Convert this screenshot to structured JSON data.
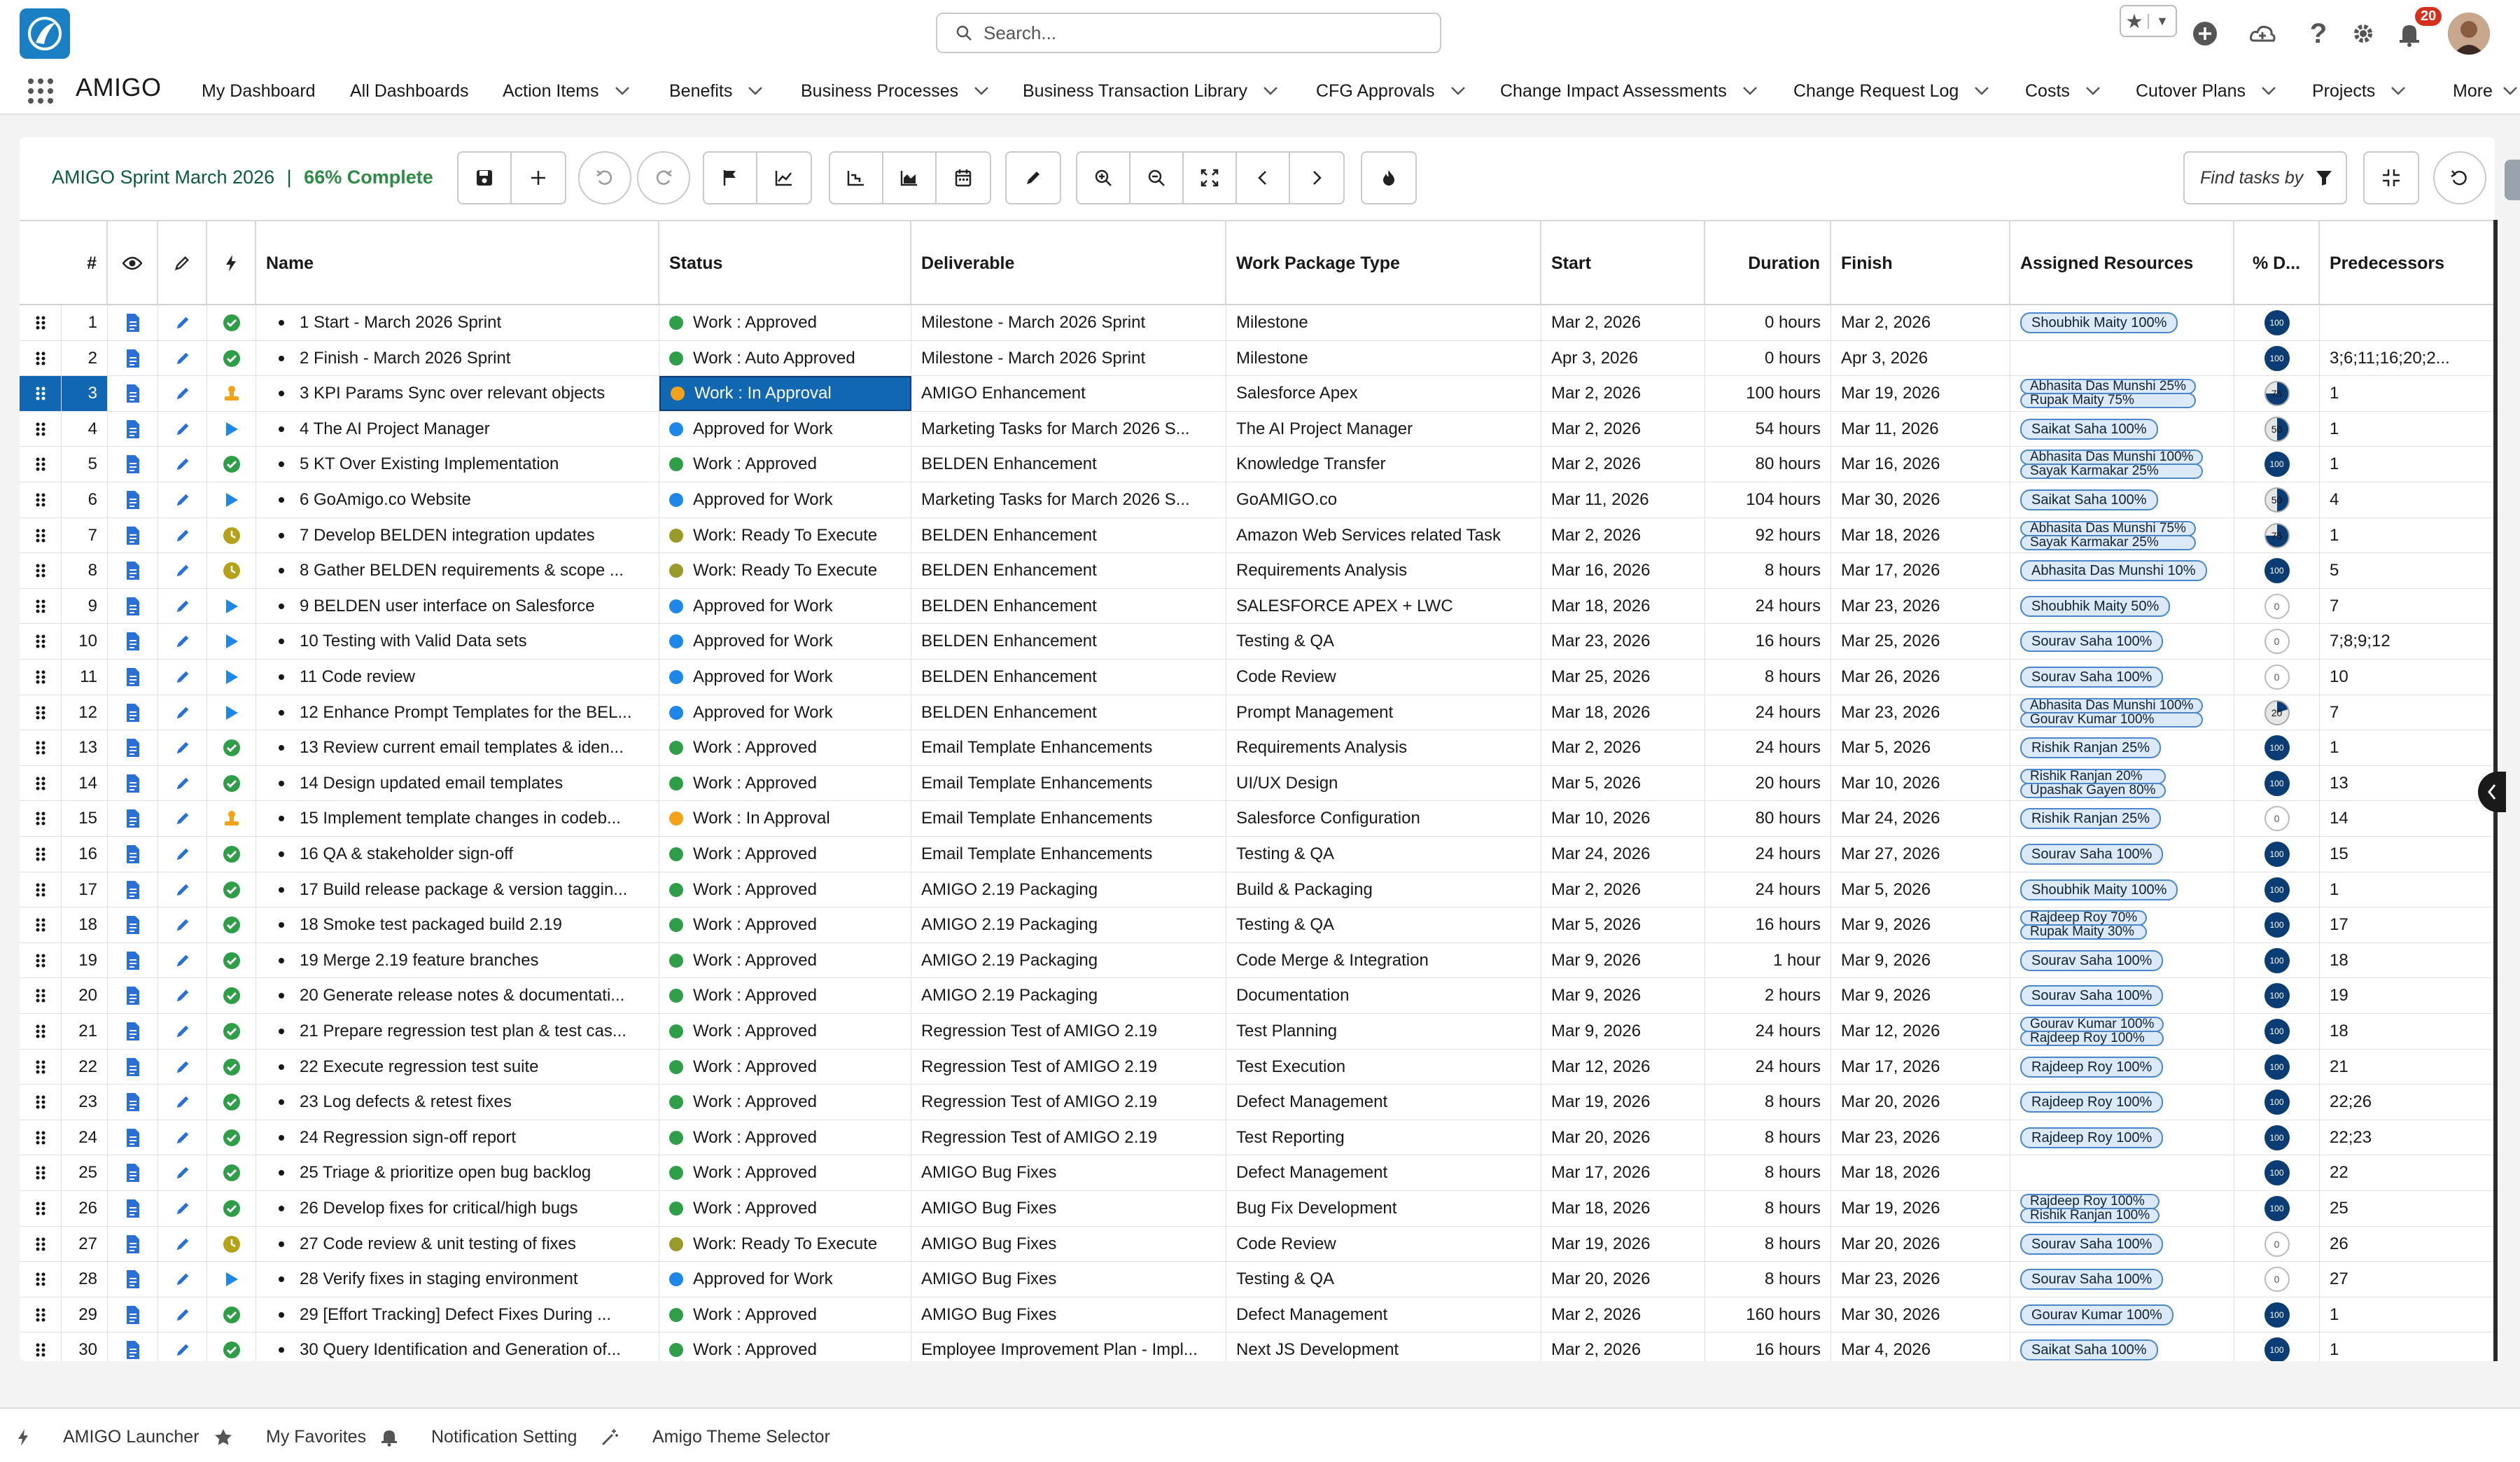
{
  "app": {
    "name": "AMIGO",
    "notification_count": "20"
  },
  "search": {
    "placeholder": "Search..."
  },
  "nav": {
    "items": [
      {
        "label": "My Dashboard",
        "dropdown": false
      },
      {
        "label": "All Dashboards",
        "dropdown": false
      },
      {
        "label": "Action Items",
        "dropdown": true
      },
      {
        "label": "Benefits",
        "dropdown": true
      },
      {
        "label": "Business Processes",
        "dropdown": true
      },
      {
        "label": "Business Transaction Library",
        "dropdown": true
      },
      {
        "label": "CFG Approvals",
        "dropdown": true
      },
      {
        "label": "Change Impact Assessments",
        "dropdown": true
      },
      {
        "label": "Change Request Log",
        "dropdown": true
      },
      {
        "label": "Costs",
        "dropdown": true
      },
      {
        "label": "Cutover Plans",
        "dropdown": true
      },
      {
        "label": "Projects",
        "dropdown": true
      },
      {
        "label": "More",
        "dropdown": true
      }
    ]
  },
  "project": {
    "name": "AMIGO Sprint March 2026",
    "separator": "|",
    "complete": "66% Complete"
  },
  "find": {
    "placeholder": "Find tasks by"
  },
  "columns": {
    "num": "#",
    "name": "Name",
    "status": "Status",
    "deliverable": "Deliverable",
    "wptype": "Work Package Type",
    "start": "Start",
    "duration": "Duration",
    "finish": "Finish",
    "resources": "Assigned Resources",
    "pct": "% D...",
    "pred": "Predecessors"
  },
  "status_colors": {
    "approved": "#2e9e48",
    "in_approval": "#f2a21b",
    "ready": "#9a9a2a",
    "approved_for_work": "#1f87e8"
  },
  "rows": [
    {
      "n": "1",
      "icon": "check",
      "name": "1 Start - March 2026 Sprint",
      "status": "Work : Approved",
      "sc": "approved",
      "deliverable": "Milestone - March 2026 Sprint",
      "wptype": "Milestone",
      "start": "Mar 2, 2026",
      "duration": "0 hours",
      "finish": "Mar 2, 2026",
      "res": [
        "Shoubhik Maity 100%"
      ],
      "pct": "100",
      "pred": ""
    },
    {
      "n": "2",
      "icon": "check",
      "name": "2 Finish - March 2026 Sprint",
      "status": "Work : Auto Approved",
      "sc": "approved",
      "deliverable": "Milestone - March 2026 Sprint",
      "wptype": "Milestone",
      "start": "Apr 3, 2026",
      "duration": "0 hours",
      "finish": "Apr 3, 2026",
      "res": [],
      "pct": "100",
      "pred": "3;6;11;16;20;2..."
    },
    {
      "n": "3",
      "icon": "stamp",
      "name": "3 KPI Params Sync over relevant objects",
      "status": "Work : In Approval",
      "sc": "in_approval",
      "deliverable": "AMIGO Enhancement",
      "wptype": "Salesforce Apex",
      "start": "Mar 2, 2026",
      "duration": "100 hours",
      "finish": "Mar 19, 2026",
      "res": [
        "Abhasita Das Munshi 25%",
        "Rupak Maity 75%"
      ],
      "pct": "75",
      "pred": "1",
      "selected": true
    },
    {
      "n": "4",
      "icon": "play",
      "name": "4 The AI Project Manager",
      "status": "Approved for Work",
      "sc": "approved_for_work",
      "deliverable": "Marketing Tasks for March 2026 S...",
      "wptype": "The AI Project Manager",
      "start": "Mar 2, 2026",
      "duration": "54 hours",
      "finish": "Mar 11, 2026",
      "res": [
        "Saikat Saha 100%"
      ],
      "pct": "50",
      "pred": "1"
    },
    {
      "n": "5",
      "icon": "check",
      "name": "5 KT Over Existing Implementation",
      "status": "Work : Approved",
      "sc": "approved",
      "deliverable": "BELDEN Enhancement",
      "wptype": "Knowledge Transfer",
      "start": "Mar 2, 2026",
      "duration": "80 hours",
      "finish": "Mar 16, 2026",
      "res": [
        "Abhasita Das Munshi 100%",
        "Sayak Karmakar 25%"
      ],
      "pct": "100",
      "pred": "1"
    },
    {
      "n": "6",
      "icon": "play",
      "name": "6 GoAmigo.co Website",
      "status": "Approved for Work",
      "sc": "approved_for_work",
      "deliverable": "Marketing Tasks for March 2026 S...",
      "wptype": "GoAMIGO.co",
      "start": "Mar 11, 2026",
      "duration": "104 hours",
      "finish": "Mar 30, 2026",
      "res": [
        "Saikat Saha 100%"
      ],
      "pct": "50",
      "pred": "4"
    },
    {
      "n": "7",
      "icon": "clock",
      "name": "7 Develop BELDEN integration updates",
      "status": "Work: Ready To Execute",
      "sc": "ready",
      "deliverable": "BELDEN Enhancement",
      "wptype": "Amazon Web Services related Task",
      "start": "Mar 2, 2026",
      "duration": "92 hours",
      "finish": "Mar 18, 2026",
      "res": [
        "Abhasita Das Munshi 75%",
        "Sayak Karmakar 25%"
      ],
      "pct": "75",
      "pred": "1"
    },
    {
      "n": "8",
      "icon": "clock",
      "name": "8 Gather BELDEN requirements & scope ...",
      "status": "Work: Ready To Execute",
      "sc": "ready",
      "deliverable": "BELDEN Enhancement",
      "wptype": "Requirements Analysis",
      "start": "Mar 16, 2026",
      "duration": "8 hours",
      "finish": "Mar 17, 2026",
      "res": [
        "Abhasita Das Munshi 10%"
      ],
      "pct": "100",
      "pred": "5"
    },
    {
      "n": "9",
      "icon": "play",
      "name": "9 BELDEN user interface on Salesforce",
      "status": "Approved for Work",
      "sc": "approved_for_work",
      "deliverable": "BELDEN Enhancement",
      "wptype": "SALESFORCE APEX + LWC",
      "start": "Mar 18, 2026",
      "duration": "24 hours",
      "finish": "Mar 23, 2026",
      "res": [
        "Shoubhik Maity 50%"
      ],
      "pct": "0",
      "pred": "7"
    },
    {
      "n": "10",
      "icon": "play",
      "name": "10 Testing with Valid Data sets",
      "status": "Approved for Work",
      "sc": "approved_for_work",
      "deliverable": "BELDEN Enhancement",
      "wptype": "Testing & QA",
      "start": "Mar 23, 2026",
      "duration": "16 hours",
      "finish": "Mar 25, 2026",
      "res": [
        "Sourav Saha 100%"
      ],
      "pct": "0",
      "pred": "7;8;9;12"
    },
    {
      "n": "11",
      "icon": "play",
      "name": "11 Code review",
      "status": "Approved for Work",
      "sc": "approved_for_work",
      "deliverable": "BELDEN Enhancement",
      "wptype": "Code Review",
      "start": "Mar 25, 2026",
      "duration": "8 hours",
      "finish": "Mar 26, 2026",
      "res": [
        "Sourav Saha 100%"
      ],
      "pct": "0",
      "pred": "10"
    },
    {
      "n": "12",
      "icon": "play",
      "name": "12 Enhance Prompt Templates for the BEL...",
      "status": "Approved for Work",
      "sc": "approved_for_work",
      "deliverable": "BELDEN Enhancement",
      "wptype": "Prompt Management",
      "start": "Mar 18, 2026",
      "duration": "24 hours",
      "finish": "Mar 23, 2026",
      "res": [
        "Abhasita Das Munshi 100%",
        "Gourav Kumar 100%"
      ],
      "pct": "20",
      "pred": "7"
    },
    {
      "n": "13",
      "icon": "check",
      "name": "13 Review current email templates & iden...",
      "status": "Work : Approved",
      "sc": "approved",
      "deliverable": "Email Template Enhancements",
      "wptype": "Requirements Analysis",
      "start": "Mar 2, 2026",
      "duration": "24 hours",
      "finish": "Mar 5, 2026",
      "res": [
        "Rishik Ranjan 25%"
      ],
      "pct": "100",
      "pred": "1"
    },
    {
      "n": "14",
      "icon": "check",
      "name": "14 Design updated email templates",
      "status": "Work : Approved",
      "sc": "approved",
      "deliverable": "Email Template Enhancements",
      "wptype": "UI/UX Design",
      "start": "Mar 5, 2026",
      "duration": "20 hours",
      "finish": "Mar 10, 2026",
      "res": [
        "Rishik Ranjan 20%",
        "Upashak Gayen 80%"
      ],
      "pct": "100",
      "pred": "13"
    },
    {
      "n": "15",
      "icon": "stamp",
      "name": "15 Implement template changes in codeb...",
      "status": "Work : In Approval",
      "sc": "in_approval",
      "deliverable": "Email Template Enhancements",
      "wptype": "Salesforce Configuration",
      "start": "Mar 10, 2026",
      "duration": "80 hours",
      "finish": "Mar 24, 2026",
      "res": [
        "Rishik Ranjan 25%"
      ],
      "pct": "0",
      "pred": "14"
    },
    {
      "n": "16",
      "icon": "check",
      "name": "16 QA & stakeholder sign-off",
      "status": "Work : Approved",
      "sc": "approved",
      "deliverable": "Email Template Enhancements",
      "wptype": "Testing & QA",
      "start": "Mar 24, 2026",
      "duration": "24 hours",
      "finish": "Mar 27, 2026",
      "res": [
        "Sourav Saha 100%"
      ],
      "pct": "100",
      "pred": "15"
    },
    {
      "n": "17",
      "icon": "check",
      "name": "17 Build release package & version taggin...",
      "status": "Work : Approved",
      "sc": "approved",
      "deliverable": "AMIGO 2.19 Packaging",
      "wptype": "Build & Packaging",
      "start": "Mar 2, 2026",
      "duration": "24 hours",
      "finish": "Mar 5, 2026",
      "res": [
        "Shoubhik Maity 100%"
      ],
      "pct": "100",
      "pred": "1"
    },
    {
      "n": "18",
      "icon": "check",
      "name": "18 Smoke test packaged build 2.19",
      "status": "Work : Approved",
      "sc": "approved",
      "deliverable": "AMIGO 2.19 Packaging",
      "wptype": "Testing & QA",
      "start": "Mar 5, 2026",
      "duration": "16 hours",
      "finish": "Mar 9, 2026",
      "res": [
        "Rajdeep Roy 70%",
        "Rupak Maity 30%"
      ],
      "pct": "100",
      "pred": "17"
    },
    {
      "n": "19",
      "icon": "check",
      "name": "19 Merge 2.19 feature branches",
      "status": "Work : Approved",
      "sc": "approved",
      "deliverable": "AMIGO 2.19 Packaging",
      "wptype": "Code Merge & Integration",
      "start": "Mar 9, 2026",
      "duration": "1 hour",
      "finish": "Mar 9, 2026",
      "res": [
        "Sourav Saha 100%"
      ],
      "pct": "100",
      "pred": "18"
    },
    {
      "n": "20",
      "icon": "check",
      "name": "20 Generate release notes & documentati...",
      "status": "Work : Approved",
      "sc": "approved",
      "deliverable": "AMIGO 2.19 Packaging",
      "wptype": "Documentation",
      "start": "Mar 9, 2026",
      "duration": "2 hours",
      "finish": "Mar 9, 2026",
      "res": [
        "Sourav Saha 100%"
      ],
      "pct": "100",
      "pred": "19"
    },
    {
      "n": "21",
      "icon": "check",
      "name": "21 Prepare regression test plan & test cas...",
      "status": "Work : Approved",
      "sc": "approved",
      "deliverable": "Regression Test of AMIGO 2.19",
      "wptype": "Test Planning",
      "start": "Mar 9, 2026",
      "duration": "24 hours",
      "finish": "Mar 12, 2026",
      "res": [
        "Gourav Kumar 100%",
        "Rajdeep Roy 100%"
      ],
      "pct": "100",
      "pred": "18"
    },
    {
      "n": "22",
      "icon": "check",
      "name": "22 Execute regression test suite",
      "status": "Work : Approved",
      "sc": "approved",
      "deliverable": "Regression Test of AMIGO 2.19",
      "wptype": "Test Execution",
      "start": "Mar 12, 2026",
      "duration": "24 hours",
      "finish": "Mar 17, 2026",
      "res": [
        "Rajdeep Roy 100%"
      ],
      "pct": "100",
      "pred": "21"
    },
    {
      "n": "23",
      "icon": "check",
      "name": "23 Log defects & retest fixes",
      "status": "Work : Approved",
      "sc": "approved",
      "deliverable": "Regression Test of AMIGO 2.19",
      "wptype": "Defect Management",
      "start": "Mar 19, 2026",
      "duration": "8 hours",
      "finish": "Mar 20, 2026",
      "res": [
        "Rajdeep Roy 100%"
      ],
      "pct": "100",
      "pred": "22;26"
    },
    {
      "n": "24",
      "icon": "check",
      "name": "24 Regression sign-off report",
      "status": "Work : Approved",
      "sc": "approved",
      "deliverable": "Regression Test of AMIGO 2.19",
      "wptype": "Test Reporting",
      "start": "Mar 20, 2026",
      "duration": "8 hours",
      "finish": "Mar 23, 2026",
      "res": [
        "Rajdeep Roy 100%"
      ],
      "pct": "100",
      "pred": "22;23"
    },
    {
      "n": "25",
      "icon": "check",
      "name": "25 Triage & prioritize open bug backlog",
      "status": "Work : Approved",
      "sc": "approved",
      "deliverable": "AMIGO Bug Fixes",
      "wptype": "Defect Management",
      "start": "Mar 17, 2026",
      "duration": "8 hours",
      "finish": "Mar 18, 2026",
      "res": [],
      "pct": "100",
      "pred": "22"
    },
    {
      "n": "26",
      "icon": "check",
      "name": "26 Develop fixes for critical/high bugs",
      "status": "Work : Approved",
      "sc": "approved",
      "deliverable": "AMIGO Bug Fixes",
      "wptype": "Bug Fix Development",
      "start": "Mar 18, 2026",
      "duration": "8 hours",
      "finish": "Mar 19, 2026",
      "res": [
        "Rajdeep Roy 100%",
        "Rishik Ranjan 100%"
      ],
      "pct": "100",
      "pred": "25"
    },
    {
      "n": "27",
      "icon": "clock",
      "name": "27 Code review & unit testing of fixes",
      "status": "Work: Ready To Execute",
      "sc": "ready",
      "deliverable": "AMIGO Bug Fixes",
      "wptype": "Code Review",
      "start": "Mar 19, 2026",
      "duration": "8 hours",
      "finish": "Mar 20, 2026",
      "res": [
        "Sourav Saha 100%"
      ],
      "pct": "0",
      "pred": "26"
    },
    {
      "n": "28",
      "icon": "play",
      "name": "28 Verify fixes in staging environment",
      "status": "Approved for Work",
      "sc": "approved_for_work",
      "deliverable": "AMIGO Bug Fixes",
      "wptype": "Testing & QA",
      "start": "Mar 20, 2026",
      "duration": "8 hours",
      "finish": "Mar 23, 2026",
      "res": [
        "Sourav Saha 100%"
      ],
      "pct": "0",
      "pred": "27"
    },
    {
      "n": "29",
      "icon": "check",
      "name": "29 [Effort Tracking] Defect Fixes During ...",
      "status": "Work : Approved",
      "sc": "approved",
      "deliverable": "AMIGO Bug Fixes",
      "wptype": "Defect Management",
      "start": "Mar 2, 2026",
      "duration": "160 hours",
      "finish": "Mar 30, 2026",
      "res": [
        "Gourav Kumar 100%"
      ],
      "pct": "100",
      "pred": "1"
    },
    {
      "n": "30",
      "icon": "check",
      "name": "30 Query Identification and Generation of...",
      "status": "Work : Approved",
      "sc": "approved",
      "deliverable": "Employee Improvement Plan - Impl...",
      "wptype": "Next JS Development",
      "start": "Mar 2, 2026",
      "duration": "16 hours",
      "finish": "Mar 4, 2026",
      "res": [
        "Saikat Saha 100%"
      ],
      "pct": "100",
      "pred": "1"
    }
  ],
  "footer": [
    {
      "label": "AMIGO Launcher",
      "icon": "bolt-icon"
    },
    {
      "label": "My Favorites",
      "icon": "star-icon"
    },
    {
      "label": "Notification Setting",
      "icon": "bell-icon"
    },
    {
      "label": "Amigo Theme Selector",
      "icon": "magic-wand-icon"
    }
  ]
}
